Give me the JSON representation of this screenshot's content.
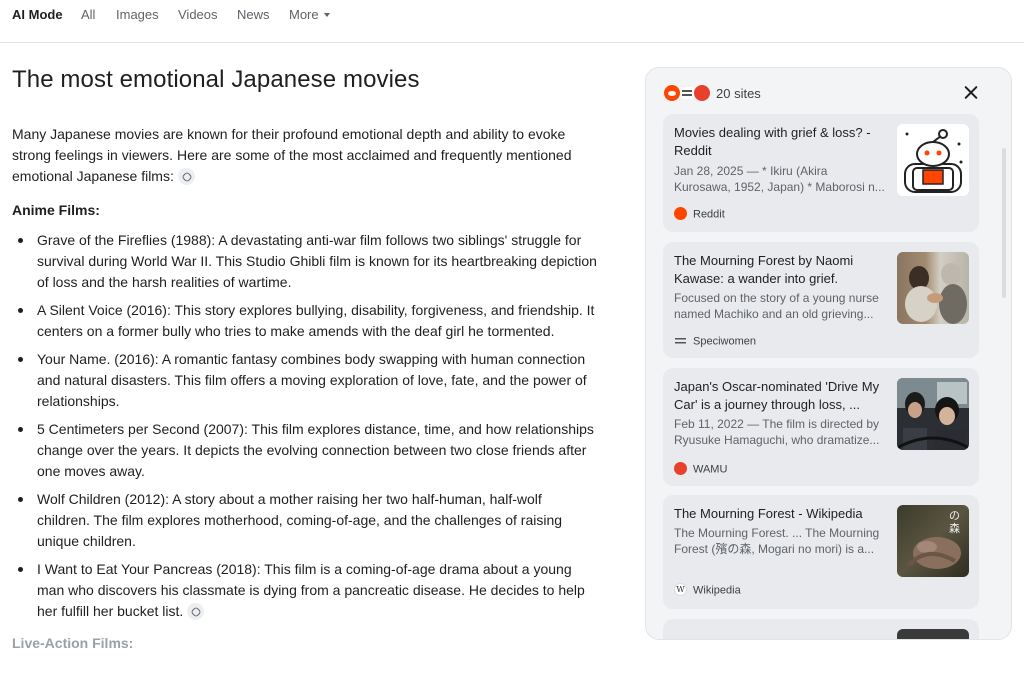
{
  "nav": {
    "tabs": [
      "AI Mode",
      "All",
      "Images",
      "Videos",
      "News",
      "More"
    ]
  },
  "main": {
    "title": "The most emotional Japanese movies",
    "intro": "Many Japanese movies are known for their profound emotional depth and ability to evoke strong feelings in viewers. Here are some of the most acclaimed and frequently mentioned emotional Japanese films:",
    "anime_heading": "Anime Films:",
    "anime_items": [
      "Grave of the Fireflies (1988): A devastating anti-war film follows two siblings' struggle for survival during World War II. This Studio Ghibli film is known for its heartbreaking depiction of loss and the harsh realities of wartime.",
      "A Silent Voice (2016): This story explores bullying, disability, forgiveness, and friendship. It centers on a former bully who tries to make amends with the deaf girl he tormented.",
      "Your Name. (2016): A romantic fantasy combines body swapping with human connection and natural disasters. This film offers a moving exploration of love, fate, and the power of relationships.",
      "5 Centimeters per Second (2007): This film explores distance, time, and how relationships change over the years. It depicts the evolving connection between two close friends after one moves away.",
      "Wolf Children (2012): A story about a mother raising her two half-human, half-wolf children. The film explores motherhood, coming-of-age, and the challenges of raising unique children.",
      "I Want to Eat Your Pancreas (2018): This film is a coming-of-age drama about a young man who discovers his classmate is dying from a pancreatic disease. He decides to help her fulfill her bucket list."
    ],
    "live_action_heading": "Live-Action Films:"
  },
  "sources": {
    "count_label": "20 sites",
    "cards": [
      {
        "title": "Movies dealing with grief & loss? - Reddit",
        "snippet_1": "Jan 28, 2025 — * Ikiru (Akira",
        "snippet_2": "Kurosawa, 1952, Japan) * Maborosi n...",
        "source": "Reddit",
        "icon": "reddit-icon",
        "color": "#ff4500"
      },
      {
        "title": "The Mourning Forest by Naomi Kawase: a wander into grief.",
        "snippet_1": "Focused on the story of a young nurse",
        "snippet_2": "named Machiko and an old grieving...",
        "source": "Speciwomen",
        "icon": "speciwomen-icon",
        "color": "#555555"
      },
      {
        "title": "Japan's Oscar-nominated 'Drive My Car' is a journey through loss, ...",
        "snippet_1": "Feb 11, 2022 — The film is directed by",
        "snippet_2": "Ryusuke Hamaguchi, who dramatize...",
        "source": "WAMU",
        "icon": "wamu-icon",
        "color": "#e8402a"
      },
      {
        "title": "The Mourning Forest - Wikipedia",
        "snippet_1": "The Mourning Forest. ... The Mourning",
        "snippet_2": "Forest (殯の森, Mogari no mori) is a...",
        "source": "Wikipedia",
        "icon": "wikipedia-icon",
        "color": "#ffffff",
        "thumb_text": "の森"
      }
    ]
  }
}
